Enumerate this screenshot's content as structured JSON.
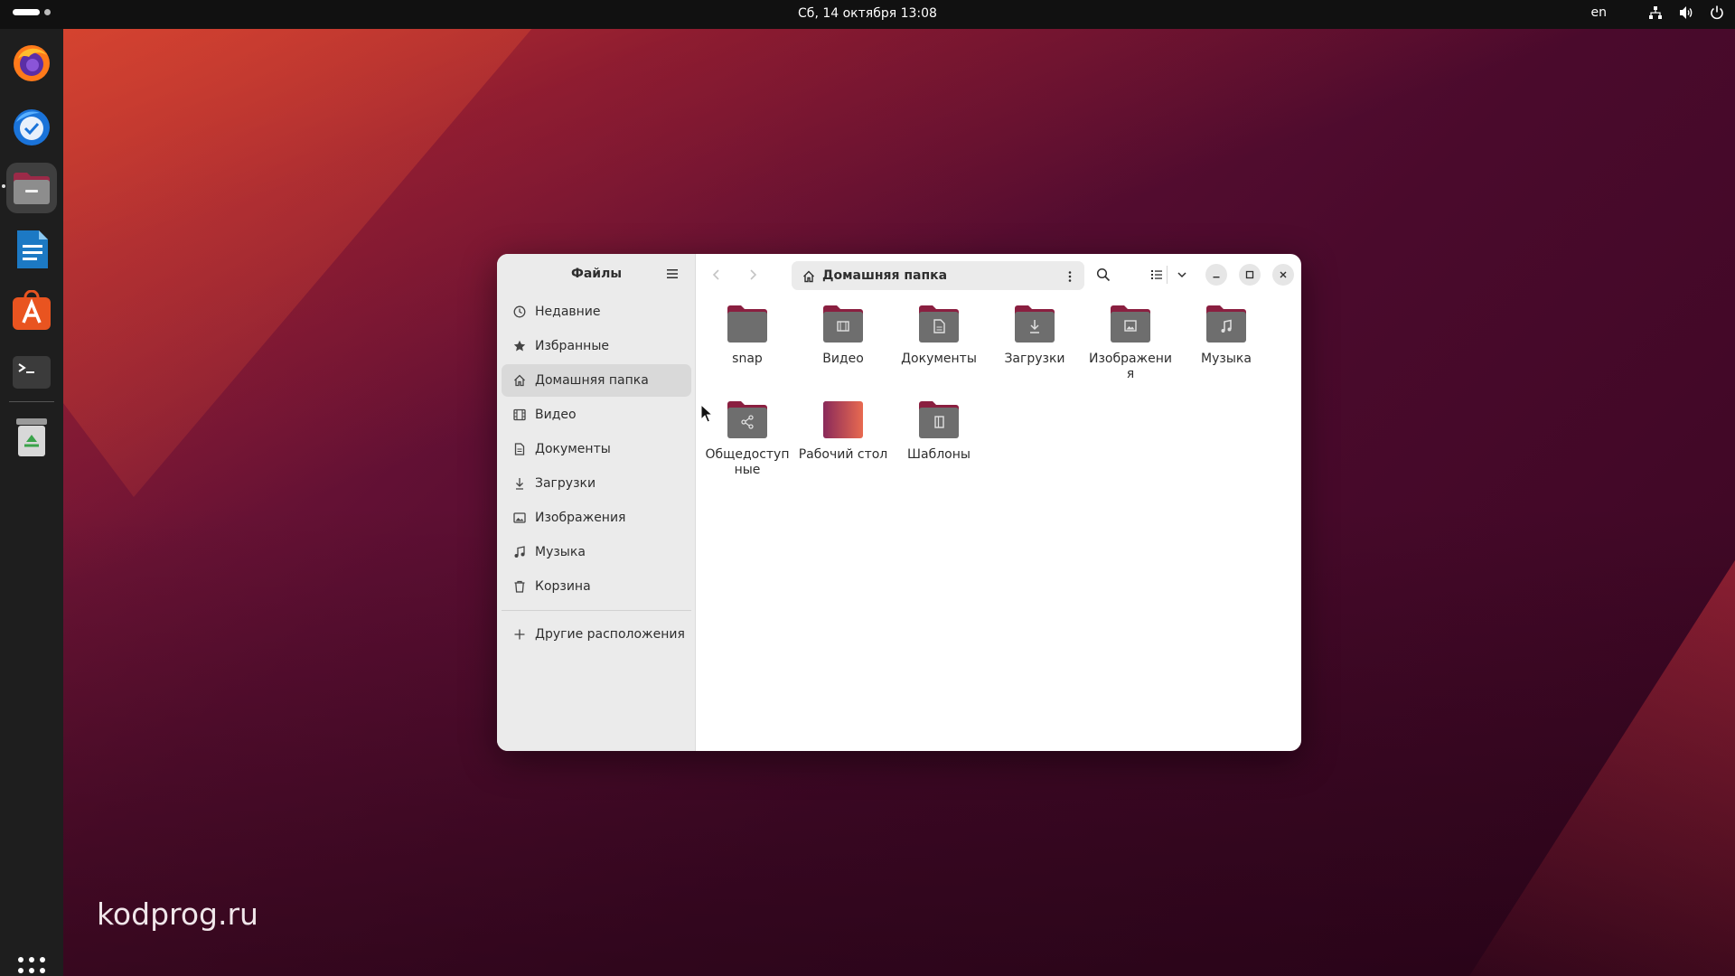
{
  "topbar": {
    "clock": "Сб, 14 октября  13:08",
    "language": "en"
  },
  "dock": {
    "apps": [
      {
        "name": "firefox-icon"
      },
      {
        "name": "thunderbird-icon"
      },
      {
        "name": "files-icon",
        "active": true
      },
      {
        "name": "writer-icon"
      },
      {
        "name": "app-center-icon"
      },
      {
        "name": "terminal-icon"
      },
      {
        "name": "trash-icon"
      }
    ]
  },
  "watermark": "kodprog.ru",
  "window": {
    "sidebar": {
      "title": "Файлы",
      "items": [
        {
          "label": "Недавние",
          "icon": "clock-icon"
        },
        {
          "label": "Избранные",
          "icon": "star-icon"
        },
        {
          "label": "Домашняя папка",
          "icon": "home-icon",
          "active": true
        },
        {
          "label": "Видео",
          "icon": "film-icon"
        },
        {
          "label": "Документы",
          "icon": "document-icon"
        },
        {
          "label": "Загрузки",
          "icon": "download-icon"
        },
        {
          "label": "Изображения",
          "icon": "image-icon"
        },
        {
          "label": "Музыка",
          "icon": "music-icon"
        },
        {
          "label": "Корзина",
          "icon": "trash-icon"
        }
      ],
      "other_locations": "Другие расположения"
    },
    "path": "Домашняя папка",
    "files": [
      {
        "label": "snap",
        "emblem": "none"
      },
      {
        "label": "Видео",
        "emblem": "film"
      },
      {
        "label": "Документы",
        "emblem": "document"
      },
      {
        "label": "Загрузки",
        "emblem": "download"
      },
      {
        "label": "Изображения",
        "emblem": "image"
      },
      {
        "label": "Музыка",
        "emblem": "music"
      },
      {
        "label": "Общедоступные",
        "emblem": "share"
      },
      {
        "label": "Рабочий стол",
        "emblem": "desktop"
      },
      {
        "label": "Шаблоны",
        "emblem": "template"
      }
    ]
  },
  "colors": {
    "folder_body": "#6e6e6e",
    "folder_tab": "#8a1f40",
    "desktop_folder": "#c0477a"
  }
}
